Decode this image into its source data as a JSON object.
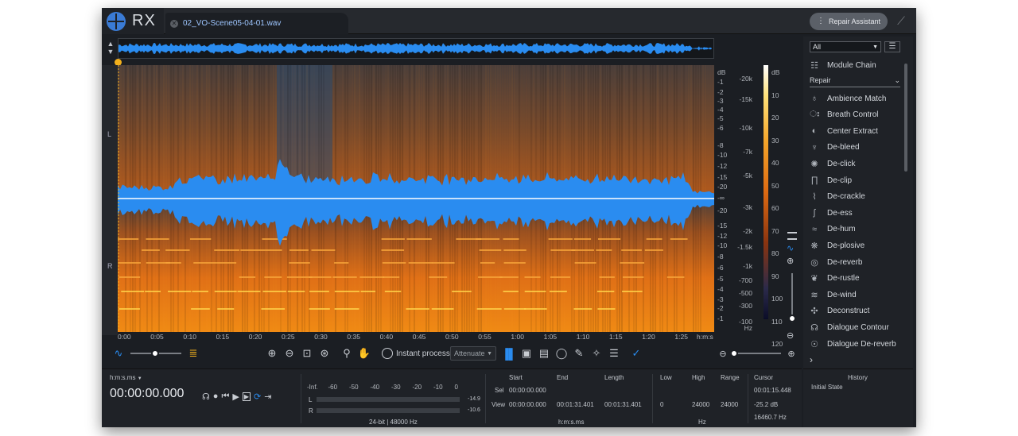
{
  "app": {
    "logo": "RX",
    "file_tab": "02_VO-Scene05-04-01.wav",
    "repair_assistant": "Repair Assistant"
  },
  "channels": {
    "left": "L",
    "right": "R"
  },
  "db_axis": [
    "dB",
    "-1",
    "-2",
    "-3",
    "-4",
    "-5",
    "-6",
    "-8",
    "-10",
    "-12",
    "-15",
    "-20",
    "-∞",
    "-20",
    "-15",
    "-12",
    "-10",
    "-8",
    "-6",
    "-5",
    "-4",
    "-3",
    "-2",
    "-1"
  ],
  "hz_axis": [
    "-20k",
    "-15k",
    "-10k",
    "-7k",
    "-5k",
    "-3k",
    "-2k",
    "-1.5k",
    "-1k",
    "-700",
    "-500",
    "-300",
    "-100",
    "Hz"
  ],
  "cbar_axis": [
    "dB",
    "10",
    "20",
    "30",
    "40",
    "50",
    "60",
    "70",
    "80",
    "90",
    "100",
    "110",
    "120"
  ],
  "time_ruler": [
    "0:00",
    "0:05",
    "0:10",
    "0:15",
    "0:20",
    "0:25",
    "0:30",
    "0:35",
    "0:40",
    "0:45",
    "0:50",
    "0:55",
    "1:00",
    "1:05",
    "1:10",
    "1:15",
    "1:20",
    "1:25",
    "h:m:s"
  ],
  "toolbar": {
    "instant_process": "Instant process",
    "attenuate": "Attenuate"
  },
  "bottom": {
    "time_format": "h:m:s.ms",
    "time_value": "00:00:00.000",
    "meter_scale": [
      "-Inf.",
      "-60",
      "-50",
      "-40",
      "-30",
      "-20",
      "-10",
      "0"
    ],
    "meter_L": "L",
    "meter_R": "R",
    "peak_L": "-14.9",
    "peak_R": "-10.6",
    "format": "24-bit | 48000 Hz",
    "hdr_start": "Start",
    "hdr_end": "End",
    "hdr_length": "Length",
    "row_sel": "Sel",
    "row_view": "View",
    "sel_start": "00:00:00.000",
    "view_start": "00:00:00.000",
    "view_end": "00:01:31.401",
    "view_length": "00:01:31.401",
    "time_unit": "h:m:s.ms",
    "hdr_low": "Low",
    "hdr_high": "High",
    "hdr_range": "Range",
    "low": "0",
    "high": "24000",
    "range": "24000",
    "freq_unit": "Hz",
    "hdr_cursor": "Cursor",
    "cursor_time": "00:01:15.448",
    "cursor_db": "-25.2 dB",
    "cursor_hz": "16460.7 Hz"
  },
  "right_panel": {
    "filter": "All",
    "module_chain": "Module Chain",
    "category": "Repair",
    "modules": [
      {
        "label": "Ambience Match",
        "icon": "ambience-icon"
      },
      {
        "label": "Breath Control",
        "icon": "breath-icon"
      },
      {
        "label": "Center Extract",
        "icon": "center-icon"
      },
      {
        "label": "De-bleed",
        "icon": "mic-icon"
      },
      {
        "label": "De-click",
        "icon": "click-icon"
      },
      {
        "label": "De-clip",
        "icon": "clip-icon"
      },
      {
        "label": "De-crackle",
        "icon": "crackle-icon"
      },
      {
        "label": "De-ess",
        "icon": "ess-icon"
      },
      {
        "label": "De-hum",
        "icon": "hum-icon"
      },
      {
        "label": "De-plosive",
        "icon": "plosive-icon"
      },
      {
        "label": "De-reverb",
        "icon": "reverb-icon"
      },
      {
        "label": "De-rustle",
        "icon": "rustle-icon"
      },
      {
        "label": "De-wind",
        "icon": "wind-icon"
      },
      {
        "label": "Deconstruct",
        "icon": "deconstruct-icon"
      },
      {
        "label": "Dialogue Contour",
        "icon": "contour-icon"
      },
      {
        "label": "Dialogue De-reverb",
        "icon": "dereverb-icon"
      }
    ]
  },
  "history": {
    "title": "History",
    "entry": "Initial State"
  },
  "colors": {
    "accent": "#1e90ff",
    "waveform": "#2a8cf0",
    "spectrum": "#e8781a",
    "bg": "#1b1e23"
  }
}
